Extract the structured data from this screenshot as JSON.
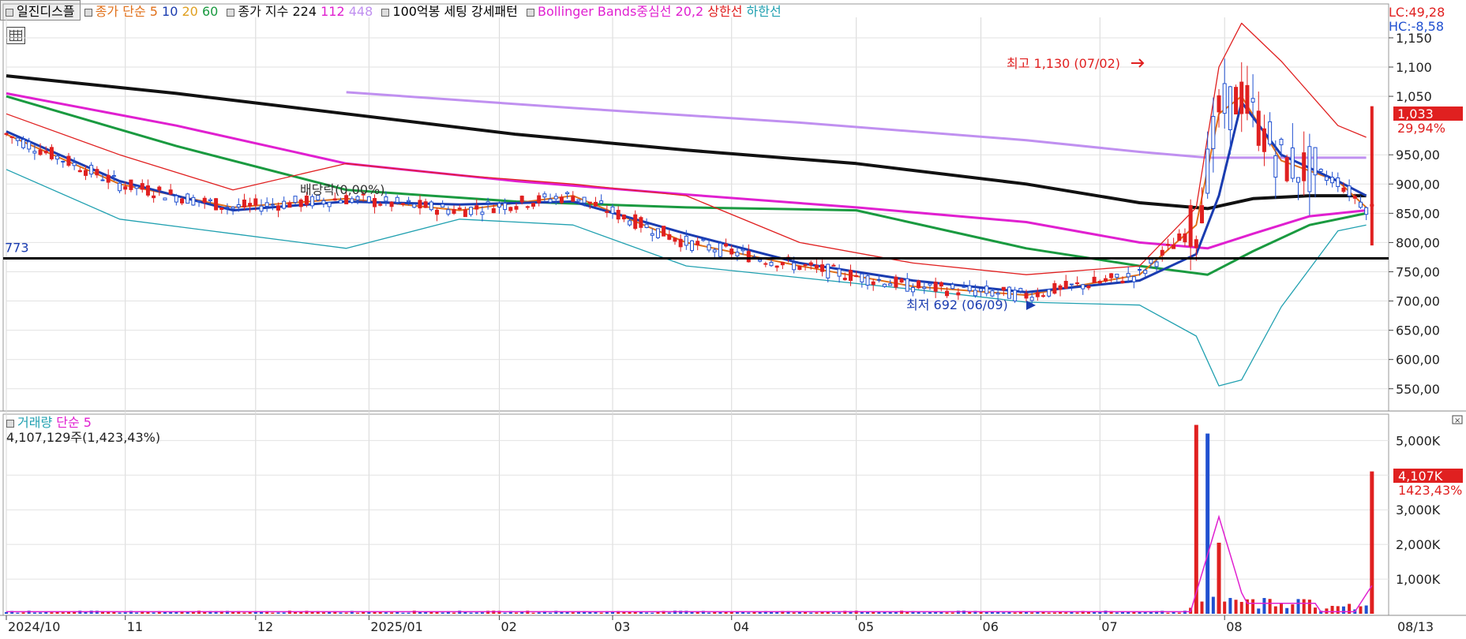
{
  "legend": {
    "toggle_label": "일진디스플",
    "ma_prefix": "종가 단순",
    "ma5": "5",
    "ma10": "10",
    "ma20": "20",
    "ma60": "60",
    "exp_prefix": "종가 지수",
    "exp224": "224",
    "exp112": "112",
    "exp448": "448",
    "pattern": "100억봉 세팅 강세패턴",
    "bb": "Bollinger Bands중심선 20,2",
    "bb_upper": "상한선",
    "bb_lower": "하한선",
    "colors": {
      "ma5": "#e0701a",
      "ma10": "#1a3cb0",
      "ma20": "#e0a020",
      "ma60": "#1a9a40",
      "exp224": "#111111",
      "exp112": "#e020d0",
      "exp448": "#c090f0",
      "bb": "#e020d0",
      "bb_upper": "#e02020",
      "bb_lower": "#20a0b0",
      "up": "#e02020",
      "down": "#2050d0"
    }
  },
  "right_info": {
    "lc": "LC:49,28",
    "hc": "HC:-8,58"
  },
  "price_panel": {
    "y_ticks": [
      "1,150",
      "1,100",
      "1,050",
      "950,00",
      "900,00",
      "850,00",
      "800,00",
      "750,00",
      "700,00",
      "650,00",
      "600,00",
      "550,00"
    ],
    "current_price": "1,033",
    "current_change": "29,94%",
    "support_label": "773",
    "high_annotation": "최고 1,130 (07/02)",
    "low_annotation": "최저 692 (06/09)",
    "dividend_annotation": "배당락(0,00%)"
  },
  "volume_panel": {
    "legend_volume": "거래량",
    "legend_ma": "단순 5",
    "summary": "4,107,129주(1,423,43%)",
    "y_ticks": [
      "5,000K",
      "4,000K",
      "3,000K",
      "2,000K",
      "1,000K"
    ],
    "current_volume": "4,107K",
    "current_change": "1423,43%"
  },
  "x_axis": {
    "labels": [
      "2024/10",
      "11",
      "12",
      "2025/01",
      "02",
      "03",
      "04",
      "05",
      "06",
      "07",
      "08"
    ],
    "current_date": "08/13"
  },
  "chart_data": {
    "type": "line",
    "title": "일진디스플",
    "price_ylim": [
      520,
      1185
    ],
    "support_level": 773,
    "high": {
      "value": 1130,
      "date": "07/02"
    },
    "low": {
      "value": 692,
      "date": "06/09"
    },
    "last_close": 1033,
    "months": [
      "2024/10",
      "11",
      "12",
      "2025/01",
      "02",
      "03",
      "04",
      "05",
      "06",
      "07",
      "08"
    ],
    "series": [
      {
        "name": "종가 지수 224",
        "x": [
          0,
          30,
          60,
          90,
          120,
          150,
          180,
          200,
          212,
          220,
          230,
          240
        ],
        "values": [
          1085,
          1055,
          1020,
          985,
          958,
          935,
          900,
          868,
          858,
          875,
          880,
          880
        ]
      },
      {
        "name": "종가 지수 112",
        "x": [
          0,
          30,
          60,
          90,
          120,
          150,
          180,
          200,
          212,
          220,
          230,
          240
        ],
        "values": [
          1055,
          1000,
          935,
          905,
          882,
          860,
          835,
          800,
          790,
          815,
          845,
          855
        ]
      },
      {
        "name": "종가 지수 448",
        "x": [
          60,
          100,
          140,
          180,
          200,
          212,
          220,
          230,
          240
        ],
        "values": [
          1057,
          1030,
          1005,
          975,
          955,
          945,
          945,
          945,
          945
        ]
      },
      {
        "name": "종가 단순 60",
        "x": [
          0,
          30,
          60,
          90,
          120,
          150,
          180,
          200,
          212,
          220,
          230,
          240
        ],
        "values": [
          1050,
          965,
          890,
          870,
          860,
          855,
          790,
          760,
          745,
          785,
          830,
          850
        ]
      },
      {
        "name": "종가 단순 5",
        "x": [
          0,
          20,
          40,
          60,
          80,
          100,
          120,
          140,
          160,
          180,
          200,
          210,
          214,
          218,
          225,
          235,
          240
        ],
        "values": [
          985,
          900,
          860,
          875,
          855,
          880,
          800,
          760,
          725,
          710,
          745,
          830,
          1020,
          1050,
          940,
          905,
          860
        ]
      },
      {
        "name": "종가 단순 10",
        "x": [
          0,
          20,
          40,
          60,
          80,
          100,
          120,
          140,
          160,
          180,
          200,
          210,
          214,
          218,
          225,
          235,
          240
        ],
        "values": [
          990,
          905,
          855,
          870,
          865,
          870,
          815,
          765,
          735,
          715,
          735,
          780,
          880,
          1040,
          950,
          905,
          880
        ]
      },
      {
        "name": "상한선",
        "x": [
          0,
          20,
          40,
          60,
          80,
          100,
          120,
          140,
          160,
          180,
          200,
          210,
          214,
          218,
          225,
          235,
          240
        ],
        "values": [
          1020,
          950,
          890,
          935,
          915,
          900,
          880,
          800,
          765,
          745,
          760,
          860,
          1100,
          1175,
          1110,
          1000,
          980
        ]
      },
      {
        "name": "하한선",
        "x": [
          0,
          20,
          40,
          60,
          80,
          100,
          120,
          140,
          160,
          180,
          200,
          210,
          214,
          218,
          225,
          235,
          240
        ],
        "values": [
          925,
          840,
          815,
          790,
          840,
          830,
          760,
          740,
          720,
          698,
          693,
          640,
          555,
          565,
          690,
          820,
          830
        ]
      }
    ],
    "volume": {
      "ylim": [
        0,
        5600
      ],
      "spike_values_k": [
        {
          "x": 210,
          "v": 5450
        },
        {
          "x": 212,
          "v": 5200
        },
        {
          "x": 214,
          "v": 2050
        },
        {
          "x": 241,
          "v": 4107
        }
      ],
      "ma5_peak_k": 2800
    }
  }
}
